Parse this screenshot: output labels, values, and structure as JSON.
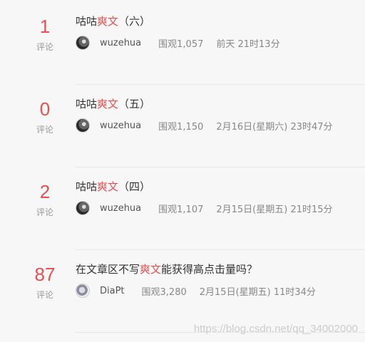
{
  "items": [
    {
      "count": "1",
      "count_label": "评论",
      "title_pre": "咕咕",
      "title_hl": "爽文",
      "title_post": "（六）",
      "author": "wuzehua",
      "views": "围观1,057",
      "time": "前天 21时13分"
    },
    {
      "count": "0",
      "count_label": "评论",
      "title_pre": "咕咕",
      "title_hl": "爽文",
      "title_post": "（五）",
      "author": "wuzehua",
      "views": "围观1,150",
      "time": "2月16日(星期六) 23时47分"
    },
    {
      "count": "2",
      "count_label": "评论",
      "title_pre": "咕咕",
      "title_hl": "爽文",
      "title_post": "（四）",
      "author": "wuzehua",
      "views": "围观1,107",
      "time": "2月15日(星期五) 21时15分"
    },
    {
      "count": "87",
      "count_label": "评论",
      "title_pre": "在文章区不写",
      "title_hl": "爽文",
      "title_post": "能获得高点击量吗？",
      "author": "DiaPt",
      "views": "围观3,280",
      "time": "2月15日(星期五) 11时34分"
    }
  ],
  "watermark": "https://blog.csdn.net/qq_34002000",
  "colors": {
    "accent": "#ea4f4f",
    "background": "#f7f7f7"
  }
}
